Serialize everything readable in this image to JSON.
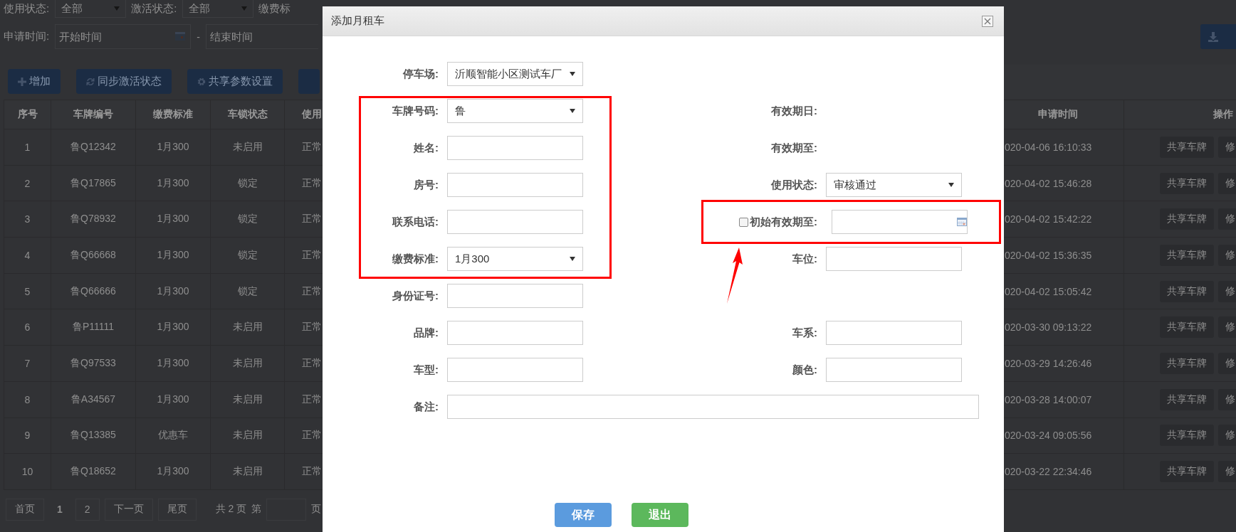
{
  "filters": [
    {
      "label": "使用状态:",
      "kind": "select",
      "value": "全部"
    },
    {
      "label": "激活状态:",
      "kind": "select",
      "value": "全部"
    },
    {
      "label": "缴费标",
      "kind": "label"
    }
  ],
  "date_filter": {
    "label": "申请时间:",
    "start_placeholder": "开始时间",
    "separator": "-",
    "end_placeholder": "结束时间"
  },
  "toolbar": [
    {
      "label": "增加"
    },
    {
      "label": "同步激活状态"
    },
    {
      "label": "共享参数设置"
    }
  ],
  "table": {
    "columns": [
      "序号",
      "车牌编号",
      "缴费标准",
      "车锁状态",
      "使用",
      "申请时间",
      "操作"
    ],
    "rows": [
      {
        "cells": [
          "1",
          "鲁Q12342",
          "1月300",
          "未启用",
          "正常",
          "020-04-06 16:10:33"
        ],
        "actions": [
          "共享车牌",
          "修"
        ]
      },
      {
        "cells": [
          "2",
          "鲁Q17865",
          "1月300",
          "锁定",
          "正常",
          "020-04-02 15:46:28"
        ],
        "actions": [
          "共享车牌",
          "修"
        ]
      },
      {
        "cells": [
          "3",
          "鲁Q78932",
          "1月300",
          "锁定",
          "正常",
          "020-04-02 15:42:22"
        ],
        "actions": [
          "共享车牌",
          "修"
        ]
      },
      {
        "cells": [
          "4",
          "鲁Q66668",
          "1月300",
          "锁定",
          "正常",
          "020-04-02 15:36:35"
        ],
        "actions": [
          "共享车牌",
          "修"
        ]
      },
      {
        "cells": [
          "5",
          "鲁Q66666",
          "1月300",
          "锁定",
          "正常",
          "020-04-02 15:05:42"
        ],
        "actions": [
          "共享车牌",
          "修"
        ]
      },
      {
        "cells": [
          "6",
          "鲁P11111",
          "1月300",
          "未启用",
          "正常",
          "020-03-30 09:13:22"
        ],
        "actions": [
          "共享车牌",
          "修"
        ]
      },
      {
        "cells": [
          "7",
          "鲁Q97533",
          "1月300",
          "未启用",
          "正常",
          "020-03-29 14:26:46"
        ],
        "actions": [
          "共享车牌",
          "修"
        ]
      },
      {
        "cells": [
          "8",
          "鲁A34567",
          "1月300",
          "未启用",
          "正常",
          "020-03-28 14:00:07"
        ],
        "actions": [
          "共享车牌",
          "修"
        ]
      },
      {
        "cells": [
          "9",
          "鲁Q13385",
          "优惠车",
          "未启用",
          "正常",
          "020-03-24 09:05:56"
        ],
        "actions": [
          "共享车牌",
          "修"
        ]
      },
      {
        "cells": [
          "10",
          "鲁Q18652",
          "1月300",
          "未启用",
          "正常",
          "020-03-22 22:34:46"
        ],
        "actions": [
          "共享车牌",
          "修"
        ]
      }
    ]
  },
  "pagination": {
    "first": "首页",
    "pages": [
      {
        "label": "1",
        "selected": true
      },
      {
        "label": "2",
        "selected": false
      }
    ],
    "next": "下一页",
    "last": "尾页",
    "total": "共 2 页",
    "goto_prefix": "第",
    "goto_suffix": "页"
  },
  "dialog": {
    "title": "添加月租车",
    "form": [
      {
        "left": {
          "label": "停车场:",
          "kind": "select",
          "value": "沂顺智能小区测试车厂"
        }
      },
      {
        "left": {
          "label": "车牌号码:",
          "kind": "select",
          "value": "鲁"
        },
        "right": {
          "label": "有效期日:",
          "kind": "static"
        }
      },
      {
        "left": {
          "label": "姓名:",
          "kind": "text"
        },
        "right": {
          "label": "有效期至:",
          "kind": "static"
        }
      },
      {
        "left": {
          "label": "房号:",
          "kind": "text"
        },
        "right": {
          "label": "使用状态:",
          "kind": "select",
          "value": "审核通过"
        }
      },
      {
        "left": {
          "label": "联系电话:",
          "kind": "text"
        },
        "right": {
          "label": "初始有效期至:",
          "kind": "checkdate",
          "checked": false
        }
      },
      {
        "left": {
          "label": "缴费标准:",
          "kind": "select",
          "value": "1月300"
        },
        "right": {
          "label": "车位:",
          "kind": "text"
        }
      },
      {
        "left": {
          "label": "身份证号:",
          "kind": "text"
        }
      },
      {
        "left": {
          "label": "品牌:",
          "kind": "text"
        },
        "right": {
          "label": "车系:",
          "kind": "text"
        }
      },
      {
        "left": {
          "label": "车型:",
          "kind": "text"
        },
        "right": {
          "label": "颜色:",
          "kind": "text"
        }
      },
      {
        "left": {
          "label": "备注:",
          "kind": "wide"
        }
      }
    ],
    "buttons": [
      {
        "label": "保存",
        "kind": "primary"
      },
      {
        "label": "退出",
        "kind": "success"
      }
    ]
  }
}
